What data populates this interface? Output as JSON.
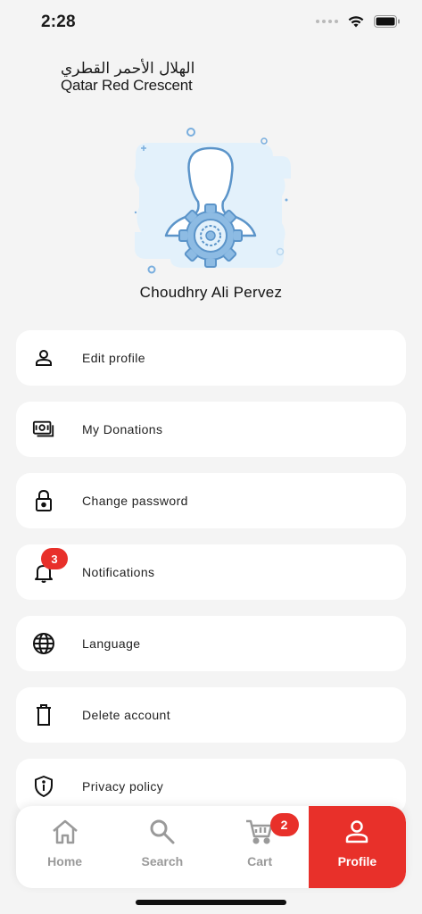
{
  "status_bar": {
    "time": "2:28"
  },
  "logo": {
    "arabic": "الهلال الأحمر القطري",
    "english": "Qatar Red Crescent",
    "brand_color": "#e8302a"
  },
  "profile": {
    "name": "Choudhry Ali Pervez"
  },
  "menu": [
    {
      "label": "Edit profile",
      "icon": "person-icon"
    },
    {
      "label": "My Donations",
      "icon": "money-icon"
    },
    {
      "label": "Change password",
      "icon": "lock-icon"
    },
    {
      "label": "Notifications",
      "icon": "bell-icon",
      "badge": "3"
    },
    {
      "label": "Language",
      "icon": "globe-icon"
    },
    {
      "label": "Delete account",
      "icon": "trash-icon"
    },
    {
      "label": "Privacy policy",
      "icon": "info-shield-icon"
    }
  ],
  "bottom_nav": {
    "items": [
      {
        "label": "Home",
        "icon": "home-icon"
      },
      {
        "label": "Search",
        "icon": "search-icon"
      },
      {
        "label": "Cart",
        "icon": "cart-icon",
        "badge": "2"
      },
      {
        "label": "Profile",
        "icon": "profile-icon",
        "active": true
      }
    ]
  },
  "colors": {
    "accent": "#e8302a",
    "background": "#f4f4f4",
    "card": "#ffffff",
    "inactive": "#9a9a9a"
  }
}
